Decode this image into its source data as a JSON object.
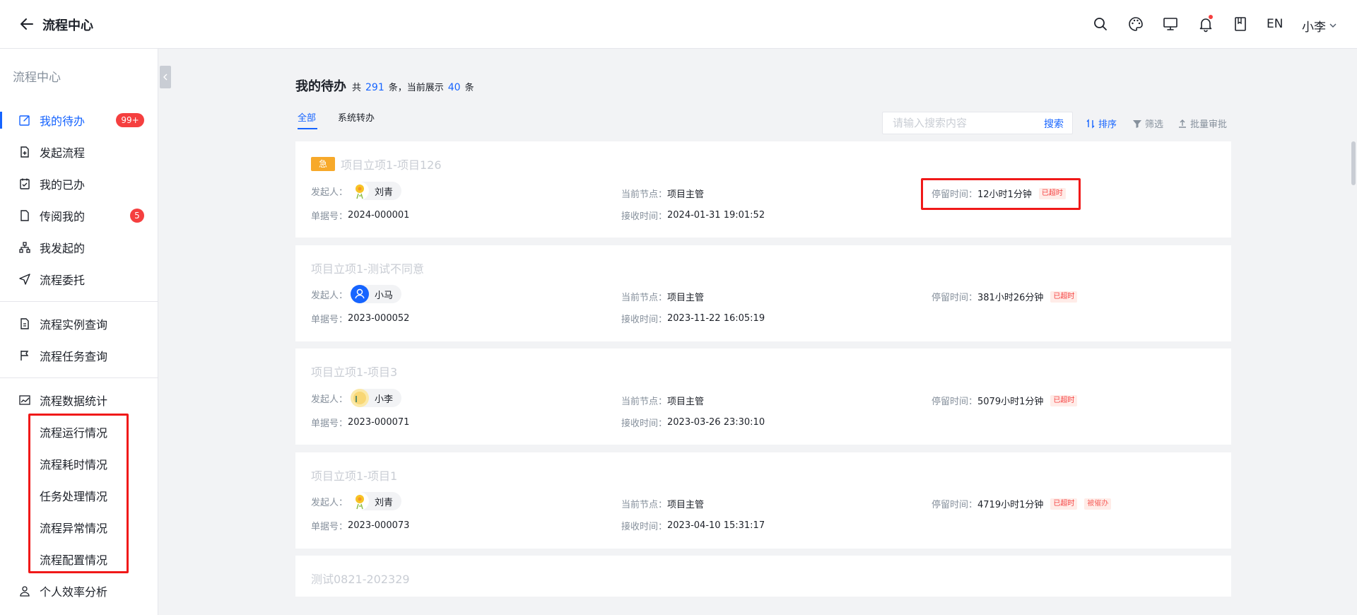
{
  "header": {
    "title": "流程中心",
    "lang": "EN",
    "user": "小李"
  },
  "sidebar": {
    "title": "流程中心",
    "items": [
      {
        "label": "我的待办",
        "icon": "edit-icon",
        "badge": "99+"
      },
      {
        "label": "发起流程",
        "icon": "file-add-icon"
      },
      {
        "label": "我的已办",
        "icon": "calendar-check-icon"
      },
      {
        "label": "传阅我的",
        "icon": "file-icon",
        "badge": "5"
      },
      {
        "label": "我发起的",
        "icon": "org-tree-icon"
      },
      {
        "label": "流程委托",
        "icon": "send-icon"
      },
      {
        "label": "流程实例查询",
        "icon": "doc-search-icon"
      },
      {
        "label": "流程任务查询",
        "icon": "flag-icon"
      },
      {
        "label": "流程数据统计",
        "icon": "line-chart-icon"
      },
      {
        "label": "流程运行情况"
      },
      {
        "label": "流程耗时情况"
      },
      {
        "label": "任务处理情况"
      },
      {
        "label": "流程异常情况"
      },
      {
        "label": "流程配置情况"
      },
      {
        "label": "个人效率分析",
        "icon": "user-chart-icon"
      }
    ]
  },
  "main": {
    "title": "我的待办",
    "total_prefix": "共",
    "total": "291",
    "total_suffix": "条，当前展示",
    "shown": "40",
    "shown_suffix": "条",
    "tabs": [
      {
        "label": "全部"
      },
      {
        "label": "系统转办"
      }
    ],
    "search": {
      "placeholder": "请输入搜索内容",
      "button": "搜索"
    },
    "tools": {
      "sort": "排序",
      "filter": "筛选",
      "batch": "批量审批"
    },
    "field_labels": {
      "initiator": "发起人：",
      "node": "当前节点：",
      "stay": "停留时间：",
      "doc_no": "单据号：",
      "received": "接收时间："
    },
    "cards": [
      {
        "urgent": "急",
        "title": "项目立项1-项目126",
        "initiator": "刘青",
        "node": "项目主管",
        "stay": "12小时1分钟",
        "tags": [
          "已超时"
        ],
        "doc_no": "2024-000001",
        "received": "2024-01-31 19:01:52"
      },
      {
        "title": "项目立项1-测试不同意",
        "initiator": "小马",
        "node": "项目主管",
        "stay": "381小时26分钟",
        "tags": [
          "已超时"
        ],
        "doc_no": "2023-000052",
        "received": "2023-11-22 16:05:19"
      },
      {
        "title": "项目立项1-项目3",
        "initiator": "小李",
        "node": "项目主管",
        "stay": "5079小时1分钟",
        "tags": [
          "已超时"
        ],
        "doc_no": "2023-000071",
        "received": "2023-03-26 23:30:10"
      },
      {
        "title": "项目立项1-项目1",
        "initiator": "刘青",
        "node": "项目主管",
        "stay": "4719小时1分钟",
        "tags": [
          "已超时",
          "被催办"
        ],
        "doc_no": "2023-000073",
        "received": "2023-04-10 15:31:17"
      },
      {
        "title": "测试0821-202329"
      }
    ]
  },
  "colors": {
    "primary": "#1664ff",
    "danger": "#f53f3f",
    "urgent": "#f7a92a",
    "highlight": "#f01919"
  }
}
